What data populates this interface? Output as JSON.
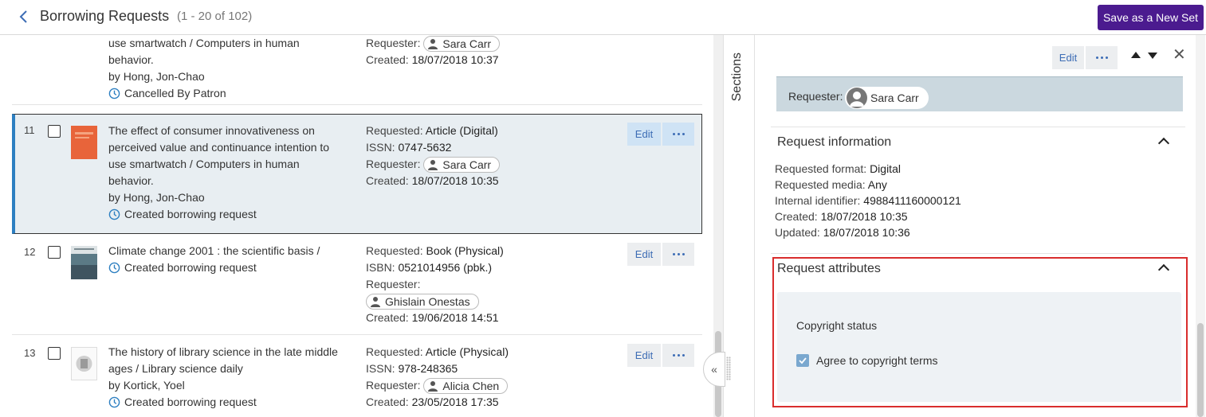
{
  "header": {
    "title": "Borrowing Requests",
    "count": "(1 - 20 of 102)",
    "save_button": "Save as a New Set"
  },
  "rows": [
    {
      "num": "",
      "title_lines": [
        "use smartwatch / Computers in human",
        "behavior."
      ],
      "author_prefix": "by",
      "author": "Hong, Jon-Chao",
      "status": "Cancelled By Patron",
      "details": {
        "requester_label": "Requester:",
        "requester": "Sara Carr",
        "created_label": "Created:",
        "created": "18/07/2018 10:37"
      }
    },
    {
      "num": "11",
      "title_lines": [
        "The effect of consumer innovativeness on",
        "perceived value and continuance intention to",
        "use smartwatch / Computers in human",
        "behavior."
      ],
      "author_prefix": "by",
      "author": "Hong, Jon-Chao",
      "status": "Created borrowing request",
      "details": {
        "requested_label": "Requested:",
        "requested": "Article (Digital)",
        "id_label": "ISSN:",
        "id": "0747-5632",
        "requester_label": "Requester:",
        "requester": "Sara Carr",
        "created_label": "Created:",
        "created": "18/07/2018 10:35"
      },
      "edit": "Edit"
    },
    {
      "num": "12",
      "title_lines": [
        "Climate change 2001 : the scientific basis /"
      ],
      "status": "Created borrowing request",
      "details": {
        "requested_label": "Requested:",
        "requested": "Book (Physical)",
        "id_label": "ISBN:",
        "id": "0521014956 (pbk.)",
        "requester_label": "Requester:",
        "requester": "Ghislain Onestas",
        "created_label": "Created:",
        "created": "19/06/2018 14:51"
      },
      "edit": "Edit"
    },
    {
      "num": "13",
      "title_lines": [
        "The history of library science in the late middle",
        "ages / Library science daily"
      ],
      "author_prefix": "by",
      "author": "Kortick, Yoel",
      "status": "Created borrowing request",
      "details": {
        "requested_label": "Requested:",
        "requested": "Article (Physical)",
        "id_label": "ISSN:",
        "id": "978-248365",
        "requester_label": "Requester:",
        "requester": "Alicia Chen",
        "created_label": "Created:",
        "created": "23/05/2018 17:35"
      },
      "edit": "Edit"
    }
  ],
  "sections_label": "Sections",
  "panel": {
    "edit": "Edit",
    "requester_label": "Requester:",
    "requester": "Sara Carr",
    "request_information": {
      "title": "Request information",
      "fields": [
        {
          "label": "Requested format:",
          "value": "Digital"
        },
        {
          "label": "Requested media:",
          "value": "Any"
        },
        {
          "label": "Internal identifier:",
          "value": "4988411160000121"
        },
        {
          "label": "Created:",
          "value": "18/07/2018 10:35"
        },
        {
          "label": "Updated:",
          "value": "18/07/2018 10:36"
        }
      ]
    },
    "request_attributes": {
      "title": "Request attributes",
      "copyright_status": "Copyright status",
      "agree_label": "Agree to copyright terms",
      "agree_checked": true
    }
  },
  "colors": {
    "accent": "#4b1b8f",
    "link": "#3d6db5",
    "selected_bg": "#e8eef2",
    "highlight_border": "#d92d2d"
  }
}
